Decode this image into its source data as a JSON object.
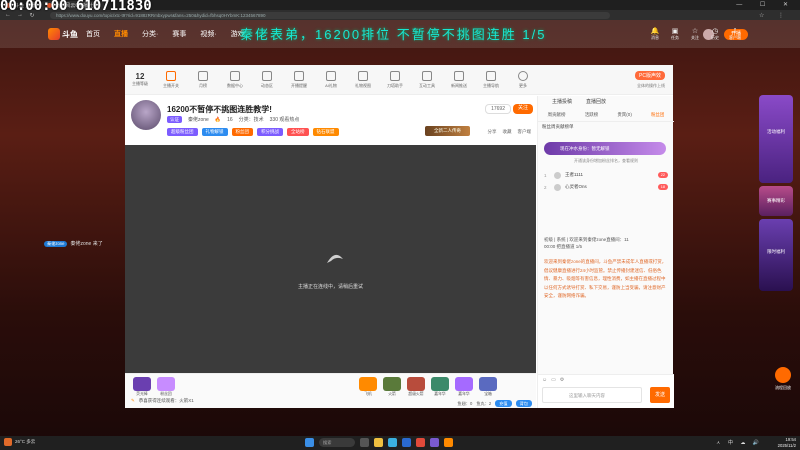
{
  "overlay": {
    "corner_text": "00:00:00 610711830",
    "marquee": "秦佬表弟，16200排位 不暂停不挑图连胜 1/5"
  },
  "browser": {
    "tabs": [
      {
        "label": "斗鱼 直播",
        "active": false
      },
      {
        "label": "战地风云6热播社区",
        "active": true
      }
    ],
    "url": "https://www.douyu.com/topic/xtc-t9?rid=9188zRRmbxypwr&fans=250&hydid=fbhsq0HYbmK:1234567890",
    "window_controls": "— ☐ ✕"
  },
  "site": {
    "logo_text": "斗鱼",
    "nav": [
      {
        "label": "首页",
        "active": false
      },
      {
        "label": "直播",
        "active": true
      },
      {
        "label": "分类·",
        "active": false
      },
      {
        "label": "赛事",
        "active": false
      },
      {
        "label": "视频·",
        "active": false
      },
      {
        "label": "游戏",
        "active": false
      }
    ],
    "header_icons": [
      {
        "icon": "bell",
        "label": "消息"
      },
      {
        "icon": "box",
        "label": "任务"
      },
      {
        "icon": "star",
        "label": "关注"
      },
      {
        "icon": "clock",
        "label": "历史"
      },
      {
        "icon": "download",
        "label": "客户端"
      },
      {
        "icon": "gift",
        "label": "福利"
      }
    ],
    "live_button": "开播"
  },
  "toolbar": {
    "count": "12",
    "count_label": "主播等级",
    "items": [
      "主播开关",
      "月榜",
      "数据中心",
      "动态区",
      "开播提醒",
      "AI礼物",
      "礼物视图",
      "刀塔助手",
      "互动工具",
      "新闻推送",
      "主播导航",
      "更多"
    ],
    "pc_label": "PC版声效",
    "pc_sub": "全体的操作上线"
  },
  "stream": {
    "title": "16200不暂停不挑图连胜教学!",
    "tags": [
      "认证",
      "网易主播",
      "精彩直播",
      "王者主播"
    ],
    "meta": [
      "秦佬zone",
      "16",
      "分类：技术",
      "330 观看热点"
    ],
    "follow_count": "17692",
    "follow_label": "关注",
    "badges": [
      {
        "text": "超级粉丝团",
        "color": "#7c5cff"
      },
      {
        "text": "礼物解锁",
        "color": "#2d8cf0"
      },
      {
        "text": "粉丝团",
        "color": "#ff6a00"
      },
      {
        "text": "积分挑战",
        "color": "#7c5cff"
      },
      {
        "text": "全站榜",
        "color": "#ff5252"
      },
      {
        "text": "钻石联盟",
        "color": "#ff8a00"
      }
    ],
    "mini_banner": "全新二人传奇",
    "share": [
      "分享",
      "收藏",
      "客户端"
    ],
    "video_message": "主播正在连线中，请稍后重试"
  },
  "gifts": {
    "left": [
      {
        "caption": "荧光棒",
        "color": "#6a3fb0"
      },
      {
        "caption": "粉丝团",
        "color": "#c78cff"
      }
    ],
    "right": [
      {
        "caption": "飞机",
        "color": "#ff8a00"
      },
      {
        "caption": "火箭",
        "color": "#5a7a3a"
      },
      {
        "caption": "超级火箭",
        "color": "#b84c3c"
      },
      {
        "caption": "嘉年华",
        "color": "#3c8a6a"
      },
      {
        "caption": "嘉年华",
        "color": "#a56aff"
      },
      {
        "caption": "宝箱",
        "color": "#5a6ac0"
      }
    ],
    "hint": "恭喜获得连续观看：火箭X1",
    "stats": [
      "鱼翅：0",
      "鱼丸：2",
      "充值",
      "背包"
    ]
  },
  "sidebar": {
    "tabs": [
      "主播投稿",
      "直播回放"
    ],
    "subtabs": [
      {
        "label": "周贡献榜",
        "active": false
      },
      {
        "label": "活跃榜",
        "active": false
      },
      {
        "label": "贵宾(0)",
        "active": false
      },
      {
        "label": "粉丝团",
        "active": true
      }
    ],
    "rank_title": "粉丝周贡献榜单",
    "vip_bar": "现在冲水身份：暂无解锁",
    "vip_hint": "开通该身份增加粉丝排名，查看规则",
    "rank_rows": [
      {
        "num": "1",
        "name": "王者1111",
        "level": "22"
      },
      {
        "num": "2",
        "name": "心灵者Ons",
        "level": "18"
      }
    ],
    "sys_msg": "初级 | 系统 | 欢迎来到秦佬zone直播间：11",
    "sys_msg2": "00:00 把直播道 1/5",
    "notice": "欢迎来到秦佬zone的直播间，斗鱼严禁未成年人直播或打赏，倡议健康直播进行24小时监管。禁止传播封建迷信、低俗色情、暴力、吸烟等有害信息，理性消费，如主播在直播过程中以任何方式诱导打赏、私下交易，谨防上当受骗，请注意财产安全，谨防网络诈骗。",
    "input_placeholder": "这里输入聊天内容",
    "send_label": "发送"
  },
  "float_chat": {
    "badge": "秦佬zone",
    "text": "秦佬zone 来了"
  },
  "right_rail": [
    {
      "label": "活动福利",
      "color": "#8a4ac8"
    },
    {
      "label": "赛事精彩",
      "color": "#b84c8a"
    },
    {
      "label": "限时福利",
      "color": "#6a3fb0"
    }
  ],
  "mc_label": "流程回放",
  "taskbar": {
    "weather": "26°C 多云",
    "search": "搜索",
    "time": "19:54",
    "date": "2025/11/2",
    "tray": "ㅅ 中 ☁ 🔊"
  },
  "colors": {
    "accent": "#ff6a00",
    "marquee": "#18e6d2"
  }
}
